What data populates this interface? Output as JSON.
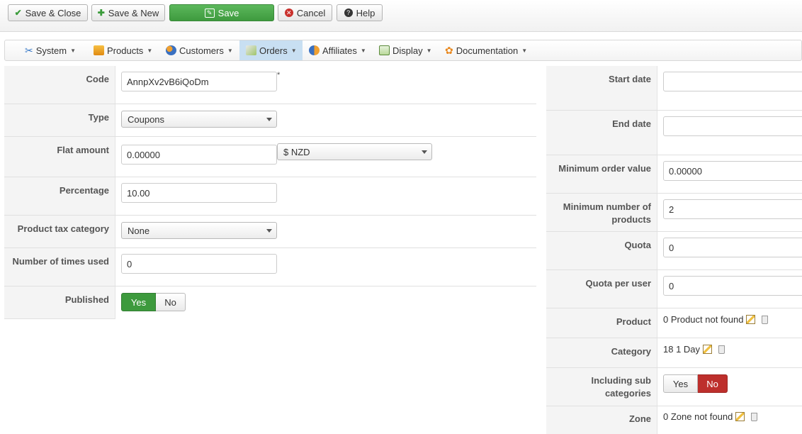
{
  "toolbar": {
    "save_close": "Save & Close",
    "save_new": "Save & New",
    "save": "Save",
    "cancel": "Cancel",
    "help": "Help"
  },
  "menu": {
    "system": "System",
    "products": "Products",
    "customers": "Customers",
    "orders": "Orders",
    "affiliates": "Affiliates",
    "display": "Display",
    "documentation": "Documentation"
  },
  "left_form": {
    "code": {
      "label": "Code",
      "value": "AnnpXv2vB6iQoDm",
      "required_mark": "*"
    },
    "type": {
      "label": "Type",
      "value": "Coupons"
    },
    "flat_amount": {
      "label": "Flat amount",
      "value": "0.00000",
      "currency": "$ NZD"
    },
    "percentage": {
      "label": "Percentage",
      "value": "10.00"
    },
    "tax_category": {
      "label": "Product tax category",
      "value": "None"
    },
    "times_used": {
      "label": "Number of times used",
      "value": "0"
    },
    "published": {
      "label": "Published",
      "yes": "Yes",
      "no": "No",
      "selected": "Yes"
    }
  },
  "right_form": {
    "start_date": {
      "label": "Start date",
      "value": ""
    },
    "end_date": {
      "label": "End date",
      "value": ""
    },
    "min_order_value": {
      "label": "Minimum order value",
      "value": "0.00000"
    },
    "min_products": {
      "label_line1": "Minimum number of",
      "label_line2": "products",
      "value": "2"
    },
    "quota": {
      "label": "Quota",
      "value": "0"
    },
    "quota_per_user": {
      "label": "Quota per user",
      "value": "0"
    },
    "product": {
      "label": "Product",
      "value": "0 Product not found"
    },
    "category": {
      "label": "Category",
      "value": "18 1 Day"
    },
    "include_sub": {
      "label_line1": "Including sub",
      "label_line2": "categories",
      "yes": "Yes",
      "no": "No",
      "selected": "No"
    },
    "zone": {
      "label": "Zone",
      "value": "0 Zone not found"
    }
  },
  "colors": {
    "save_green": "#4cae4c",
    "active_menu": "#c8dff2",
    "yes_green": "#3d9a3d",
    "no_red": "#bd2f2c"
  }
}
